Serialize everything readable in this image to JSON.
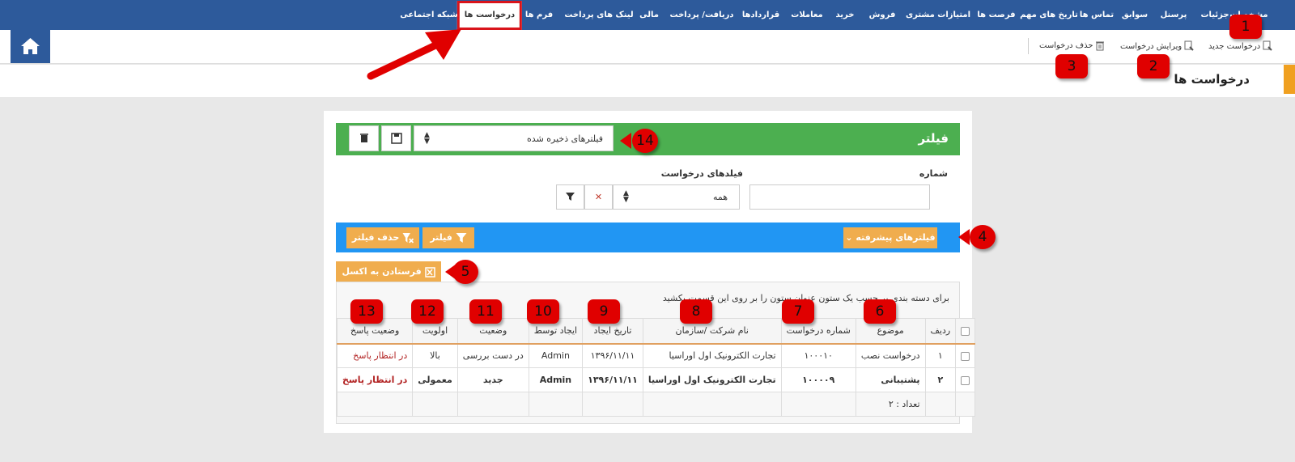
{
  "nav": {
    "items": [
      "مشخصات",
      "جزئیات",
      "پرسنل",
      "سوابق",
      "تماس ها",
      "تاریخ های مهم",
      "فرصت ها",
      "امتیازات مشتری",
      "فروش",
      "خرید",
      "معاملات",
      "قراردادها",
      "دریافت/ پرداخت",
      "مالی",
      "لینک های پرداخت",
      "فرم ها",
      "درخواست ها",
      "شبکه اجتماعی"
    ],
    "active_index": 16
  },
  "toolbar": {
    "new_request": "درخواست جدید",
    "edit_request": "ویرایش درخواست",
    "delete_request": "حذف درخواست"
  },
  "page": {
    "title": "درخواست ها"
  },
  "filter": {
    "title": "فیلتر",
    "saved_filters": "فیلترهای ذخیره شده",
    "number_label": "شماره",
    "number_value": "",
    "fields_label": "فیلدهای درخواست",
    "fields_value": "همه",
    "advanced": "فیلترهای پیشرفته",
    "apply": "فیلتر",
    "remove": "حذف فیلتر"
  },
  "export": {
    "excel": "فرستادن به اکسل"
  },
  "grid": {
    "hint": "برای دسته بندی بر حسب یک ستون عنوان ستون را بر روی این قسمت بکشید",
    "columns": [
      "ردیف",
      "موضوع",
      "شماره درخواست",
      "نام شرکت /سازمان",
      "تاریخ ایجاد",
      "ایجاد توسط",
      "وضعیت",
      "اولویت",
      "وضعیت پاسخ"
    ],
    "rows": [
      {
        "row": "۱",
        "subject": "درخواست نصب",
        "number": "۱۰۰۰۱۰",
        "company": "تجارت الکترونیک اول اوراسیا",
        "date": "۱۳۹۶/۱۱/۱۱",
        "by": "Admin",
        "status": "در دست بررسی",
        "priority": "بالا",
        "reply": "در انتظار پاسخ"
      },
      {
        "row": "۲",
        "subject": "پشتیبانی",
        "number": "۱۰۰۰۰۹",
        "company": "تجارت الکترونیک اول اوراسیا",
        "date": "۱۳۹۶/۱۱/۱۱",
        "by": "Admin",
        "status": "جدید",
        "priority": "معمولی",
        "reply": "در انتظار پاسخ"
      }
    ],
    "count": "تعداد : ۲"
  },
  "annotations": [
    "1",
    "2",
    "3",
    "4",
    "5",
    "6",
    "7",
    "8",
    "9",
    "10",
    "11",
    "12",
    "13",
    "14"
  ],
  "colors": {
    "nav": "#2d5a9b",
    "filter_bar": "#4caf50",
    "blue_bar": "#2196f3",
    "button": "#f0ad4e",
    "badge": "#e00000",
    "accent": "#f0a020"
  }
}
